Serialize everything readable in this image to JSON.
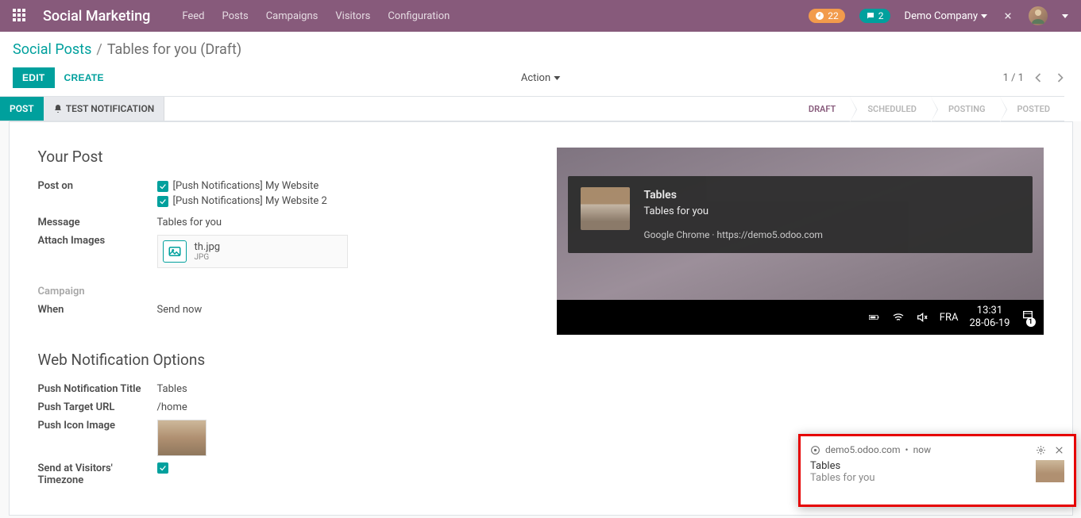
{
  "topbar": {
    "brand": "Social Marketing",
    "nav": [
      "Feed",
      "Posts",
      "Campaigns",
      "Visitors",
      "Configuration"
    ],
    "activity_count": "22",
    "discuss_count": "2",
    "company": "Demo Company"
  },
  "breadcrumb": {
    "root": "Social Posts",
    "current": "Tables for you (Draft)"
  },
  "buttons": {
    "edit": "EDIT",
    "create": "CREATE",
    "action": "Action",
    "post": "POST",
    "test_notification": "TEST NOTIFICATION"
  },
  "pager": {
    "text": "1 / 1"
  },
  "stages": [
    "DRAFT",
    "SCHEDULED",
    "POSTING",
    "POSTED"
  ],
  "active_stage": "DRAFT",
  "form": {
    "section1_title": "Your Post",
    "labels": {
      "post_on": "Post on",
      "message": "Message",
      "attach_images": "Attach Images",
      "campaign": "Campaign",
      "when": "When"
    },
    "post_on": [
      "[Push Notifications] My Website",
      "[Push Notifications] My Website 2"
    ],
    "message": "Tables for you",
    "attachment": {
      "name": "th.jpg",
      "type": "JPG"
    },
    "campaign": "",
    "when": "Send now",
    "section2_title": "Web Notification Options",
    "labels2": {
      "push_title": "Push Notification Title",
      "push_url": "Push Target URL",
      "push_icon": "Push Icon Image",
      "send_at_tz": "Send at Visitors' Timezone"
    },
    "push_title": "Tables",
    "push_url": "/home"
  },
  "preview": {
    "title": "Tables",
    "body": "Tables for you",
    "meta": "Google Chrome · https://demo5.odoo.com",
    "taskbar": {
      "lang": "FRA",
      "time": "13:31",
      "date": "28-06-19",
      "badge": "1"
    }
  },
  "notification": {
    "origin": "demo5.odoo.com",
    "when": "now",
    "title": "Tables",
    "body": "Tables for you"
  }
}
